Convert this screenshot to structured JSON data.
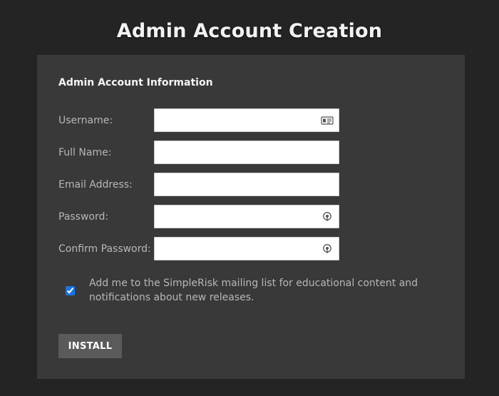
{
  "page": {
    "title": "Admin Account Creation"
  },
  "form": {
    "section_heading": "Admin Account Information",
    "username": {
      "label": "Username:",
      "value": "",
      "icon": "contact-card-icon"
    },
    "full_name": {
      "label": "Full Name:",
      "value": ""
    },
    "email": {
      "label": "Email Address:",
      "value": ""
    },
    "password": {
      "label": "Password:",
      "value": "",
      "icon": "password-key-icon"
    },
    "confirm_password": {
      "label": "Confirm Password:",
      "value": "",
      "icon": "password-key-icon"
    },
    "mailing_list": {
      "checked": true,
      "label": "Add me to the SimpleRisk mailing list for educational content and notifications about new releases."
    },
    "install_label": "INSTALL"
  },
  "colors": {
    "background": "#242424",
    "panel": "#393939",
    "button": "#5a5a5a",
    "checkbox_accent": "#1a73e8"
  }
}
